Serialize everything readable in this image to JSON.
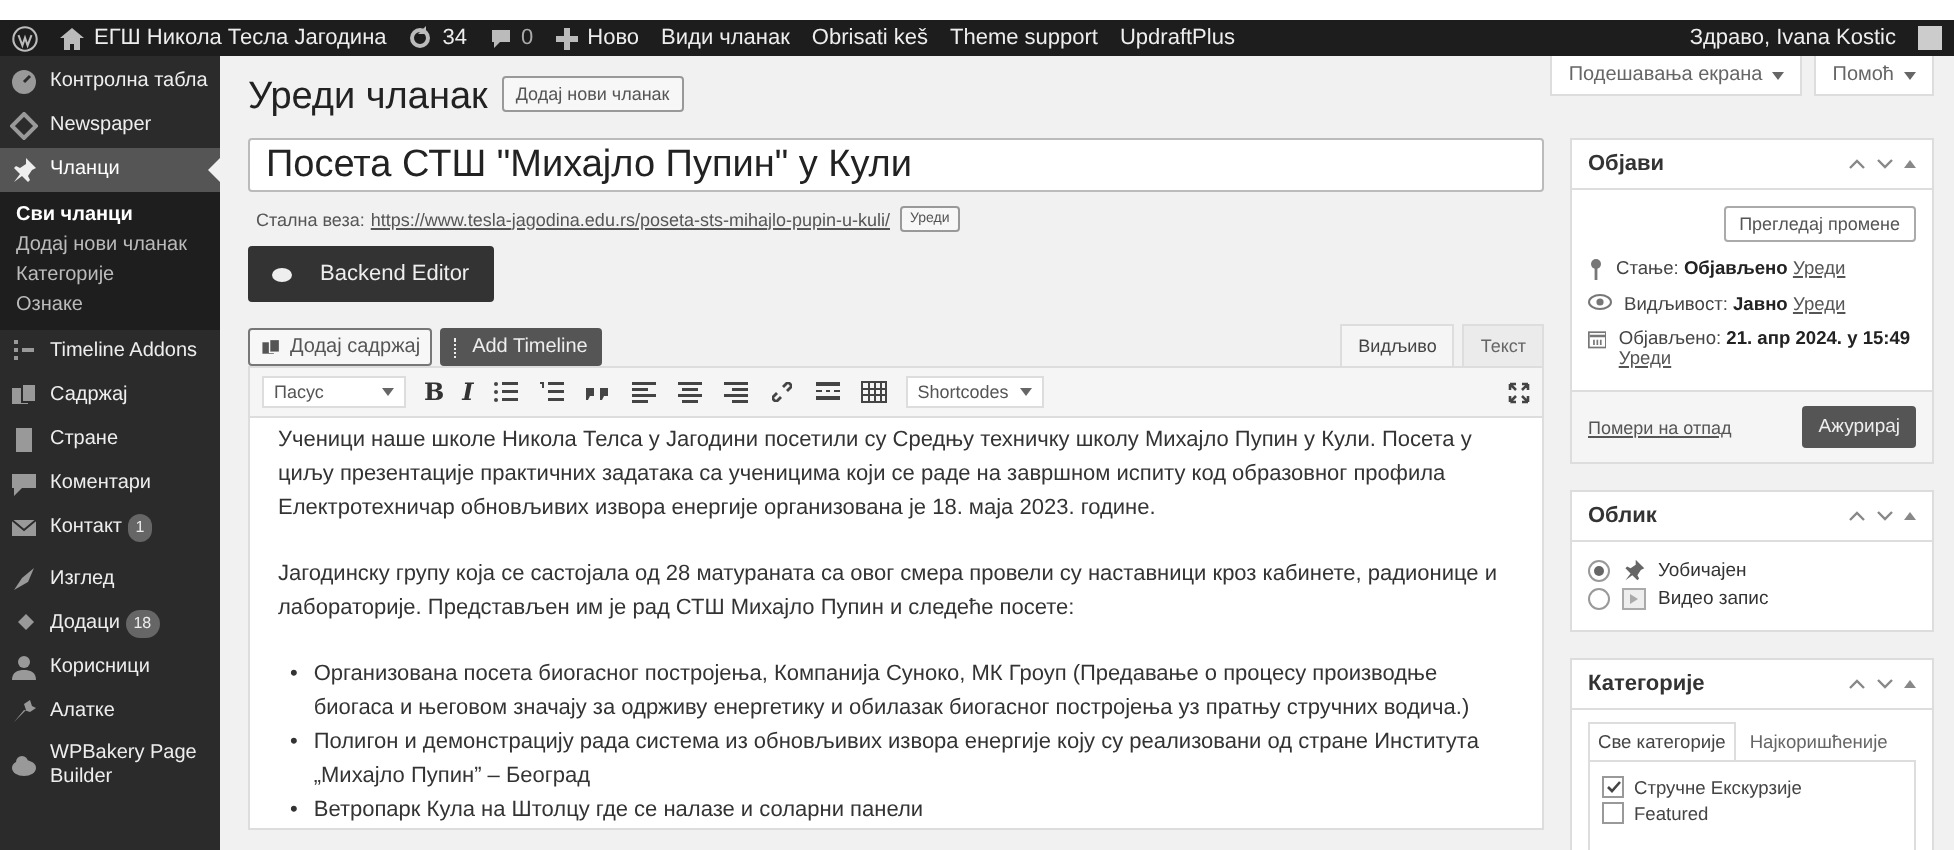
{
  "admin_bar": {
    "site": "ЕГШ Никола Тесла Јагодина",
    "updates": "34",
    "comments": "0",
    "new": "Ново",
    "links": [
      "Види чланак",
      "Obrisati keš",
      "Theme support",
      "UpdraftPlus"
    ],
    "greeting": "Здраво, Ivana Kostic"
  },
  "sidebar": {
    "items": [
      {
        "label": "Контролна табла",
        "selected": false
      },
      {
        "label": "Newspaper",
        "selected": false
      },
      {
        "label": "Чланци",
        "selected": true,
        "children": [
          {
            "label": "Сви чланци",
            "selected": true
          },
          {
            "label": "Додај нови чланак",
            "selected": false
          },
          {
            "label": "Категорије",
            "selected": false
          },
          {
            "label": "Ознаке",
            "selected": false
          }
        ]
      },
      {
        "label": "Timeline Addons",
        "selected": false
      },
      {
        "label": "Садржај",
        "selected": false
      },
      {
        "label": "Стране",
        "selected": false
      },
      {
        "label": "Коментари",
        "selected": false
      },
      {
        "label": "Контакт",
        "badge": "1",
        "selected": false
      },
      {
        "label": "Изглед",
        "selected": false
      },
      {
        "label": "Додаци",
        "badge": "18",
        "selected": false
      },
      {
        "label": "Корисници",
        "selected": false
      },
      {
        "label": "Алатке",
        "selected": false
      },
      {
        "label": "WPBakery Page Builder",
        "selected": false
      }
    ]
  },
  "screen_tabs": [
    "Подешавања екрана",
    "Помоћ"
  ],
  "heading": "Уреди чланак",
  "add_new": "Додај нови чланак",
  "title_value": "Посета СТШ \"Михајло Пупин\" у Кули",
  "permalink": {
    "label": "Стална веза:",
    "url": "https://www.tesla-jagodina.edu.rs/poseta-sts-mihajlo-pupin-u-kuli/",
    "edit": "Уреди"
  },
  "backend_editor": "Backend Editor",
  "media_buttons": [
    "Додај садржај",
    "Add Timeline"
  ],
  "editor_tabs": [
    {
      "label": "Видљиво",
      "selected": true
    },
    {
      "label": "Текст",
      "selected": false
    }
  ],
  "toolbar": {
    "format": "Пасус",
    "shortcodes": "Shortcodes",
    "buttons": [
      {
        "kind": "text",
        "label": "B"
      },
      {
        "kind": "text",
        "label": "I"
      },
      {
        "kind": "bullets"
      },
      {
        "kind": "numbers"
      },
      {
        "kind": "quote"
      },
      {
        "kind": "align-left"
      },
      {
        "kind": "align-center"
      },
      {
        "kind": "align-right"
      },
      {
        "kind": "link"
      },
      {
        "kind": "more"
      },
      {
        "kind": "grid"
      }
    ]
  },
  "content": [
    {
      "kind": "paragraph",
      "text": "Ученици наше школе  Никола Телса у Јагодини посетили су  Средњу техничку школу Михајло Пупин у Кули. Посета у циљу презентације практичних  задатака са ученицима који се раде на завршном испиту код образовног профила Електротехничар обновљивих извора енергије организована је 18. маја 2023. године."
    },
    {
      "kind": "paragraph",
      "text": "Јагодинску групу која се састојала од 28 матураната са овог смера провели су наставници    кроз кабинете, радионице и лабораторије.  Представљен им је рад СТШ Михајло Пупин и следеће посете:"
    },
    {
      "kind": "list",
      "marker": "•",
      "items": [
        "Организована посета биогасног постројења, Компанија Суноко, МК Гроуп (Предавање о процесу производње биогаса и његовом значају за одрживу енергетику и обилазак биогасног постројења уз пратњу стручних водича.)",
        "Полигон и демонстрацију рада система из обновљивих извора енергије коју су реализовани од стране Института „Михајло Пупин” – Београд",
        "Ветропарк  Кула на Штолцу где се налазе и соларни панели"
      ]
    }
  ],
  "publish": {
    "title": "Објави",
    "preview": "Прегледај промене",
    "rows": [
      {
        "kind": "status",
        "label": "Стање:",
        "value": "Објављено",
        "edit": "Уреди"
      },
      {
        "kind": "visibility",
        "label": "Видљивост:",
        "value": "Јавно",
        "edit": "Уреди"
      },
      {
        "kind": "date",
        "label": "Објављено:",
        "value": "21. апр 2024. у 15:49",
        "edit": "Уреди"
      }
    ],
    "trash": "Помери на отпад",
    "update": "Ажурирај"
  },
  "format": {
    "title": "Облик",
    "options": [
      {
        "label": "Уобичајен",
        "selected": true
      },
      {
        "label": "Видео запис",
        "selected": false
      }
    ]
  },
  "categories": {
    "title": "Категорије",
    "tabs": [
      {
        "label": "Све категорије",
        "selected": true
      },
      {
        "label": "Најкоришћеније",
        "selected": false
      }
    ],
    "items": [
      {
        "label": "Стручне Екскурзије",
        "checked": true
      },
      {
        "label": "Featured",
        "checked": false
      }
    ]
  }
}
